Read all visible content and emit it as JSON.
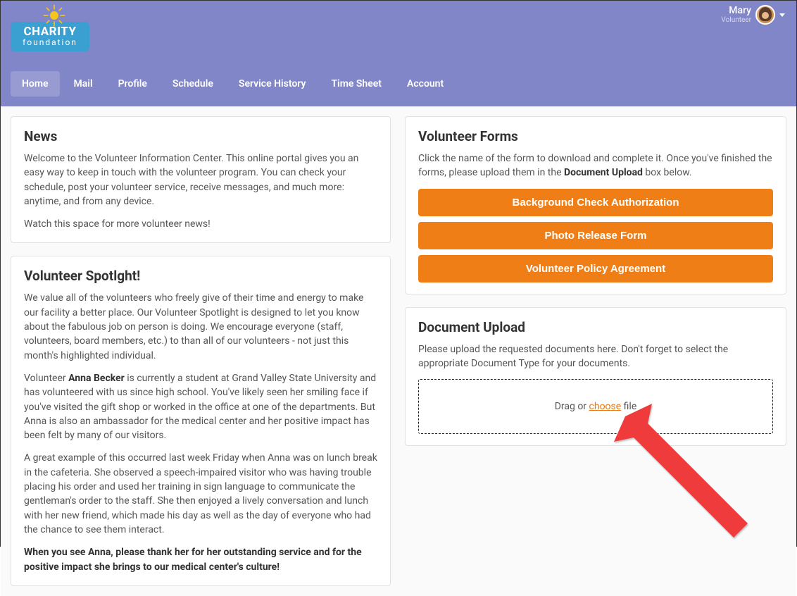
{
  "brand": {
    "line1": "CHARITY",
    "line2": "foundation"
  },
  "user": {
    "name": "Mary",
    "role": "Volunteer"
  },
  "nav": [
    {
      "label": "Home"
    },
    {
      "label": "Mail"
    },
    {
      "label": "Profile"
    },
    {
      "label": "Schedule"
    },
    {
      "label": "Service History"
    },
    {
      "label": "Time Sheet"
    },
    {
      "label": "Account"
    }
  ],
  "news": {
    "title": "News",
    "p1": "Welcome to the Volunteer Information Center. This online portal gives you an easy way to keep in touch with the volunteer program. You can check your schedule, post your volunteer service, receive messages, and much more: anytime, and from any device.",
    "p2": "Watch this space for more volunteer news!"
  },
  "spotlight": {
    "title": "Volunteer Spotlght!",
    "p1": "We value all of the volunteers who freely give of their time and energy to make our facility a better place. Our Volunteer Spotlight is designed to let you know about the fabulous job on person is doing. We encourage everyone (staff, volunteers, board members, etc.) to than all of our volunteers - not just this month's highlighted individual.",
    "p2a": "Volunteer ",
    "p2name": "Anna Becker",
    "p2b": " is currently a student at Grand Valley State University and has volunteered with us since high school. You've likely seen her smiling face if you've visited the gift shop or worked in the office at one of the departments. But Anna is also an ambassador for the medical center and her positive impact has been felt by many of our visitors.",
    "p3": "A great example of this occurred last week Friday when Anna was on lunch break in the cafeteria. She observed a speech-impaired visitor who was having trouble placing his order and used her training in sign language to communicate the gentleman's order to the staff. She then enjoyed a lively conversation and lunch with her new friend, which made his day as well as the day of everyone who had the chance to see them interact.",
    "p4": "When you see Anna, please thank her for her outstanding service and for the positive impact she brings to our medical center's culture!"
  },
  "forms": {
    "title": "Volunteer Forms",
    "intro_a": "Click the name of the form to download and complete it. Once you've finished the forms, please upload them in the ",
    "intro_strong": "Document Upload",
    "intro_b": " box below.",
    "buttons": [
      "Background Check Authorization",
      "Photo Release Form",
      "Volunteer Policy Agreement"
    ]
  },
  "upload": {
    "title": "Document Upload",
    "intro": "Please upload the requested documents here. Don't forget to select the appropriate Document Type for your documents.",
    "drop_a": "Drag or ",
    "drop_choose": "choose",
    "drop_b": " file"
  }
}
